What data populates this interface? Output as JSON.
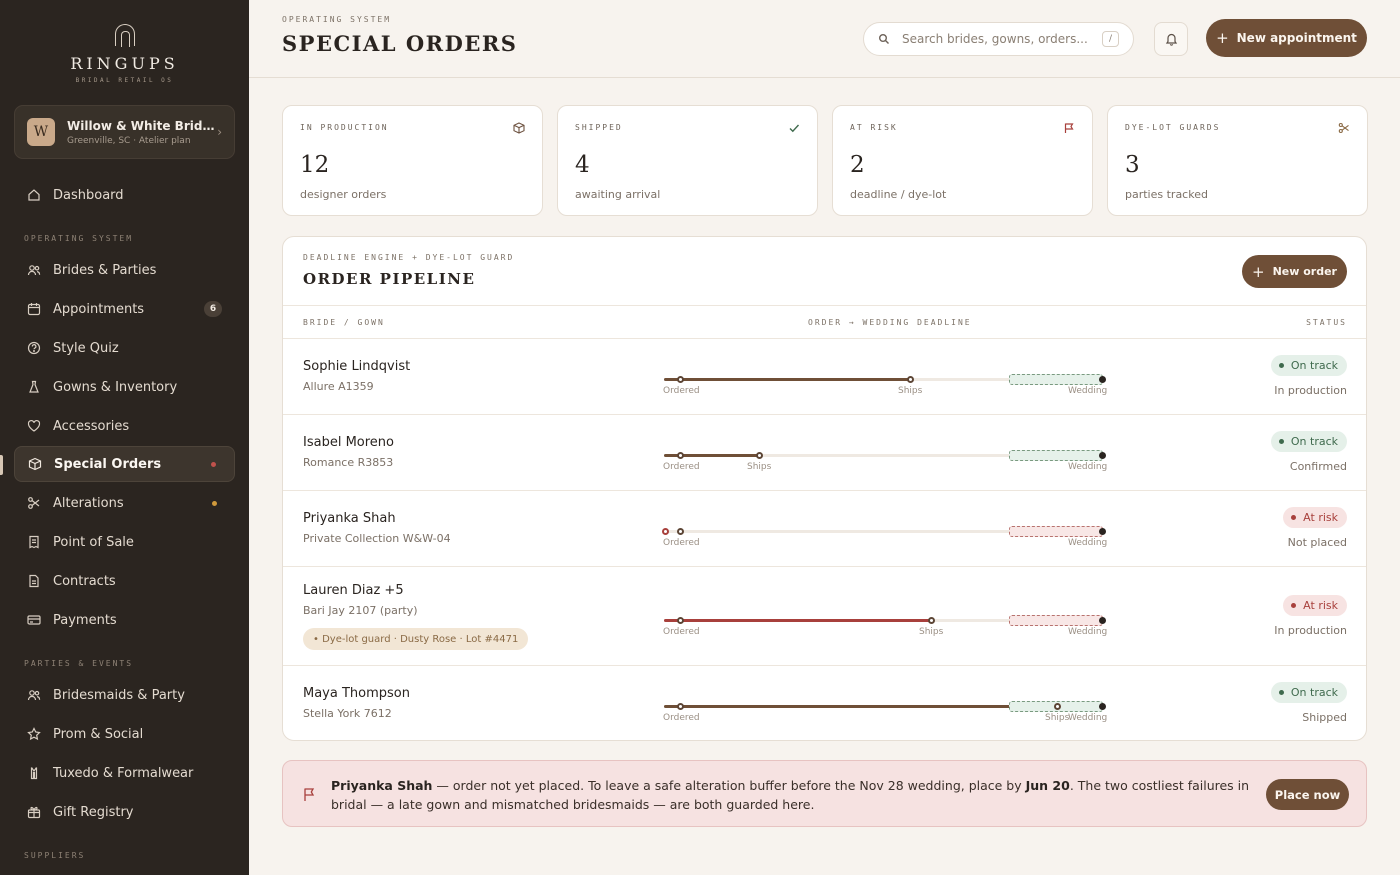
{
  "brand": {
    "name": "RINGUPS",
    "tagline": "BRIDAL RETAIL OS"
  },
  "store": {
    "badge": "W",
    "name": "Willow & White Bridal...",
    "sub": "Greenville, SC · Atelier plan"
  },
  "nav": {
    "dashboard": "Dashboard",
    "section_os": "OPERATING SYSTEM",
    "brides": "Brides & Parties",
    "appointments": "Appointments",
    "appointments_badge": "6",
    "style_quiz": "Style Quiz",
    "gowns": "Gowns & Inventory",
    "accessories": "Accessories",
    "special_orders": "Special Orders",
    "alterations": "Alterations",
    "pos": "Point of Sale",
    "contracts": "Contracts",
    "payments": "Payments",
    "section_parties": "PARTIES & EVENTS",
    "bridesmaids": "Bridesmaids & Party",
    "prom": "Prom & Social",
    "tuxedo": "Tuxedo & Formalwear",
    "registry": "Gift Registry",
    "section_suppliers": "SUPPLIERS",
    "colors": {
      "special_orders_dot": "#c0524c",
      "alterations_dot": "#d09a3c"
    }
  },
  "header": {
    "eyebrow": "OPERATING SYSTEM",
    "title": "SPECIAL ORDERS",
    "search_placeholder": "Search brides, gowns, orders...",
    "search_shortcut": "/",
    "new_appointment": "New appointment"
  },
  "stats": [
    {
      "label": "IN PRODUCTION",
      "value": "12",
      "sub": "designer orders",
      "icon": "box-icon"
    },
    {
      "label": "SHIPPED",
      "value": "4",
      "sub": "awaiting arrival",
      "icon": "check-icon"
    },
    {
      "label": "AT RISK",
      "value": "2",
      "sub": "deadline / dye-lot",
      "icon": "flag-icon"
    },
    {
      "label": "DYE-LOT GUARDS",
      "value": "3",
      "sub": "parties tracked",
      "icon": "scissors-icon"
    }
  ],
  "pipeline": {
    "eyebrow": "DEADLINE ENGINE + DYE-LOT GUARD",
    "title": "ORDER PIPELINE",
    "new_order": "New order",
    "columns": {
      "bride": "BRIDE / GOWN",
      "timeline": "ORDER → WEDDING DEADLINE",
      "status": "STATUS"
    },
    "timeline_labels": {
      "ordered": "Ordered",
      "ships": "Ships",
      "wedding": "Wedding"
    },
    "rows": [
      {
        "bride": "Sophie Lindqvist",
        "gown": "Allure A1359",
        "status": "On track",
        "state": "In production",
        "risk": false,
        "progress": 0.55,
        "ships_at": 0.55,
        "show_ships": true,
        "chip": ""
      },
      {
        "bride": "Isabel Moreno",
        "gown": "Romance R3853",
        "status": "On track",
        "state": "Confirmed",
        "risk": false,
        "progress": 0.19,
        "ships_at": 0.19,
        "show_ships": true,
        "chip": ""
      },
      {
        "bride": "Priyanka Shah",
        "gown": "Private Collection W&W-04",
        "status": "At risk",
        "state": "Not placed",
        "risk": true,
        "progress": 0.0,
        "ships_at": 0.0,
        "show_ships": false,
        "chip": ""
      },
      {
        "bride": "Lauren Diaz +5",
        "gown": "Bari Jay 2107 (party)",
        "status": "At risk",
        "state": "In production",
        "risk": true,
        "progress": 0.6,
        "ships_at": 0.6,
        "show_ships": true,
        "chip": "• Dye-lot guard · Dusty Rose · Lot #4471"
      },
      {
        "bride": "Maya Thompson",
        "gown": "Stella York 7612",
        "status": "On track",
        "state": "Shipped",
        "risk": false,
        "progress": 0.8,
        "ships_at": 0.9,
        "show_ships": true,
        "chip": ""
      }
    ]
  },
  "alert": {
    "name": "Priyanka Shah",
    "text_1": " — order not yet placed. To leave a safe alteration buffer before the Nov 28 wedding, place by ",
    "date": "Jun 20",
    "text_2": ". The two costliest failures in bridal — a late gown and mismatched bridesmaids — are both guarded here.",
    "action": "Place now"
  },
  "colors": {
    "accent": "#6f4f37",
    "sidebar": "#2b2520",
    "ok": "#3f6a4d",
    "risk": "#a8403c"
  }
}
